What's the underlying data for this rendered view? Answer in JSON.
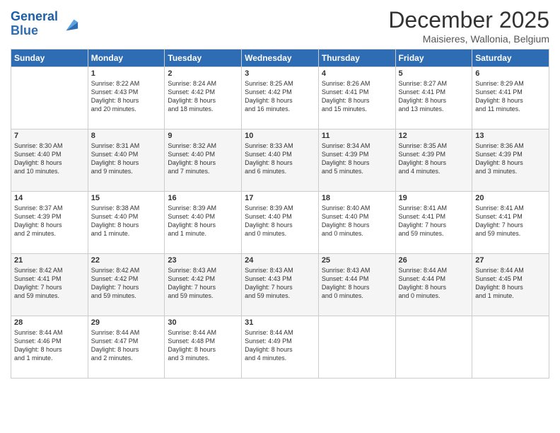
{
  "logo": {
    "line1": "General",
    "line2": "Blue"
  },
  "title": "December 2025",
  "subtitle": "Maisieres, Wallonia, Belgium",
  "days_of_week": [
    "Sunday",
    "Monday",
    "Tuesday",
    "Wednesday",
    "Thursday",
    "Friday",
    "Saturday"
  ],
  "weeks": [
    [
      {
        "day": "",
        "content": ""
      },
      {
        "day": "1",
        "content": "Sunrise: 8:22 AM\nSunset: 4:43 PM\nDaylight: 8 hours\nand 20 minutes."
      },
      {
        "day": "2",
        "content": "Sunrise: 8:24 AM\nSunset: 4:42 PM\nDaylight: 8 hours\nand 18 minutes."
      },
      {
        "day": "3",
        "content": "Sunrise: 8:25 AM\nSunset: 4:42 PM\nDaylight: 8 hours\nand 16 minutes."
      },
      {
        "day": "4",
        "content": "Sunrise: 8:26 AM\nSunset: 4:41 PM\nDaylight: 8 hours\nand 15 minutes."
      },
      {
        "day": "5",
        "content": "Sunrise: 8:27 AM\nSunset: 4:41 PM\nDaylight: 8 hours\nand 13 minutes."
      },
      {
        "day": "6",
        "content": "Sunrise: 8:29 AM\nSunset: 4:41 PM\nDaylight: 8 hours\nand 11 minutes."
      }
    ],
    [
      {
        "day": "7",
        "content": "Sunrise: 8:30 AM\nSunset: 4:40 PM\nDaylight: 8 hours\nand 10 minutes."
      },
      {
        "day": "8",
        "content": "Sunrise: 8:31 AM\nSunset: 4:40 PM\nDaylight: 8 hours\nand 9 minutes."
      },
      {
        "day": "9",
        "content": "Sunrise: 8:32 AM\nSunset: 4:40 PM\nDaylight: 8 hours\nand 7 minutes."
      },
      {
        "day": "10",
        "content": "Sunrise: 8:33 AM\nSunset: 4:40 PM\nDaylight: 8 hours\nand 6 minutes."
      },
      {
        "day": "11",
        "content": "Sunrise: 8:34 AM\nSunset: 4:39 PM\nDaylight: 8 hours\nand 5 minutes."
      },
      {
        "day": "12",
        "content": "Sunrise: 8:35 AM\nSunset: 4:39 PM\nDaylight: 8 hours\nand 4 minutes."
      },
      {
        "day": "13",
        "content": "Sunrise: 8:36 AM\nSunset: 4:39 PM\nDaylight: 8 hours\nand 3 minutes."
      }
    ],
    [
      {
        "day": "14",
        "content": "Sunrise: 8:37 AM\nSunset: 4:39 PM\nDaylight: 8 hours\nand 2 minutes."
      },
      {
        "day": "15",
        "content": "Sunrise: 8:38 AM\nSunset: 4:40 PM\nDaylight: 8 hours\nand 1 minute."
      },
      {
        "day": "16",
        "content": "Sunrise: 8:39 AM\nSunset: 4:40 PM\nDaylight: 8 hours\nand 1 minute."
      },
      {
        "day": "17",
        "content": "Sunrise: 8:39 AM\nSunset: 4:40 PM\nDaylight: 8 hours\nand 0 minutes."
      },
      {
        "day": "18",
        "content": "Sunrise: 8:40 AM\nSunset: 4:40 PM\nDaylight: 8 hours\nand 0 minutes."
      },
      {
        "day": "19",
        "content": "Sunrise: 8:41 AM\nSunset: 4:41 PM\nDaylight: 7 hours\nand 59 minutes."
      },
      {
        "day": "20",
        "content": "Sunrise: 8:41 AM\nSunset: 4:41 PM\nDaylight: 7 hours\nand 59 minutes."
      }
    ],
    [
      {
        "day": "21",
        "content": "Sunrise: 8:42 AM\nSunset: 4:41 PM\nDaylight: 7 hours\nand 59 minutes."
      },
      {
        "day": "22",
        "content": "Sunrise: 8:42 AM\nSunset: 4:42 PM\nDaylight: 7 hours\nand 59 minutes."
      },
      {
        "day": "23",
        "content": "Sunrise: 8:43 AM\nSunset: 4:42 PM\nDaylight: 7 hours\nand 59 minutes."
      },
      {
        "day": "24",
        "content": "Sunrise: 8:43 AM\nSunset: 4:43 PM\nDaylight: 7 hours\nand 59 minutes."
      },
      {
        "day": "25",
        "content": "Sunrise: 8:43 AM\nSunset: 4:44 PM\nDaylight: 8 hours\nand 0 minutes."
      },
      {
        "day": "26",
        "content": "Sunrise: 8:44 AM\nSunset: 4:44 PM\nDaylight: 8 hours\nand 0 minutes."
      },
      {
        "day": "27",
        "content": "Sunrise: 8:44 AM\nSunset: 4:45 PM\nDaylight: 8 hours\nand 1 minute."
      }
    ],
    [
      {
        "day": "28",
        "content": "Sunrise: 8:44 AM\nSunset: 4:46 PM\nDaylight: 8 hours\nand 1 minute."
      },
      {
        "day": "29",
        "content": "Sunrise: 8:44 AM\nSunset: 4:47 PM\nDaylight: 8 hours\nand 2 minutes."
      },
      {
        "day": "30",
        "content": "Sunrise: 8:44 AM\nSunset: 4:48 PM\nDaylight: 8 hours\nand 3 minutes."
      },
      {
        "day": "31",
        "content": "Sunrise: 8:44 AM\nSunset: 4:49 PM\nDaylight: 8 hours\nand 4 minutes."
      },
      {
        "day": "",
        "content": ""
      },
      {
        "day": "",
        "content": ""
      },
      {
        "day": "",
        "content": ""
      }
    ]
  ]
}
